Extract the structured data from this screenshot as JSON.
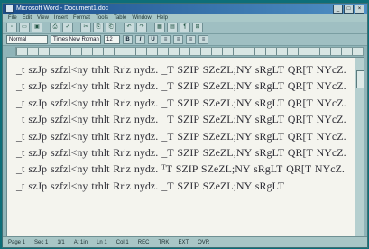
{
  "window": {
    "title": "Microsoft Word - Document1.doc",
    "controls": [
      "_",
      "□",
      "×"
    ]
  },
  "menubar": {
    "items": [
      "File",
      "Edit",
      "View",
      "Insert",
      "Format",
      "Tools",
      "Table",
      "Window",
      "Help"
    ]
  },
  "toolbar": {
    "buttons": [
      "▫",
      "▭",
      "▣",
      "⎙",
      "✓",
      "✂",
      "⎘",
      "⎗",
      "↶",
      "↷",
      "▦",
      "▤",
      "¶",
      "⊞"
    ]
  },
  "formatbar": {
    "style_value": "Normal",
    "font_value": "Times New Roman",
    "size_value": "12",
    "buttons": [
      "B",
      "I",
      "U",
      "≡",
      "≡",
      "≡",
      "≡"
    ]
  },
  "document": {
    "body_text": "_t szJp szfzl<ny trhlt Rr'z nydz. _T SZIP SZeZL;NY sRgLT QR[T NYcZ. _t szJp szfzl<ny trhlt Rr'z nydz. _T SZIP SZeZL;NY sRgLT QR[T NYcZ. _t szJp szfzl<ny trhlt Rr'z nydz. _T SZIP SZeZL;NY sRgLT QR[T NYcZ. _t szJp szfzl<ny trhlt Rr'z nydz. _T SZIP SZeZL;NY sRgLT QR[T NYcZ. _t szJp szfzl<ny trhlt Rr'z nydz. _T SZIP SZeZL;NY sRgLT QR[T NYcZ. _t szJp szfzl<ny trhlt Rr'z nydz. _T SZIP SZeZL;NY sRgLT QR[T NYcZ. _t szJp szfzl<ny trhlt Rr'z nydz. ᵀT SZIP SZeZL;NY sRgLT QR[T NYcZ. _t szJp szfzl<ny trhlt Rr'z nydz. _T SZIP SZeZL;NY sRgLT"
  },
  "statusbar": {
    "segments": [
      "Page 1",
      "Sec 1",
      "1/1",
      "At 1in",
      "Ln 1",
      "Col 1",
      "REC",
      "TRK",
      "EXT",
      "OVR"
    ]
  }
}
